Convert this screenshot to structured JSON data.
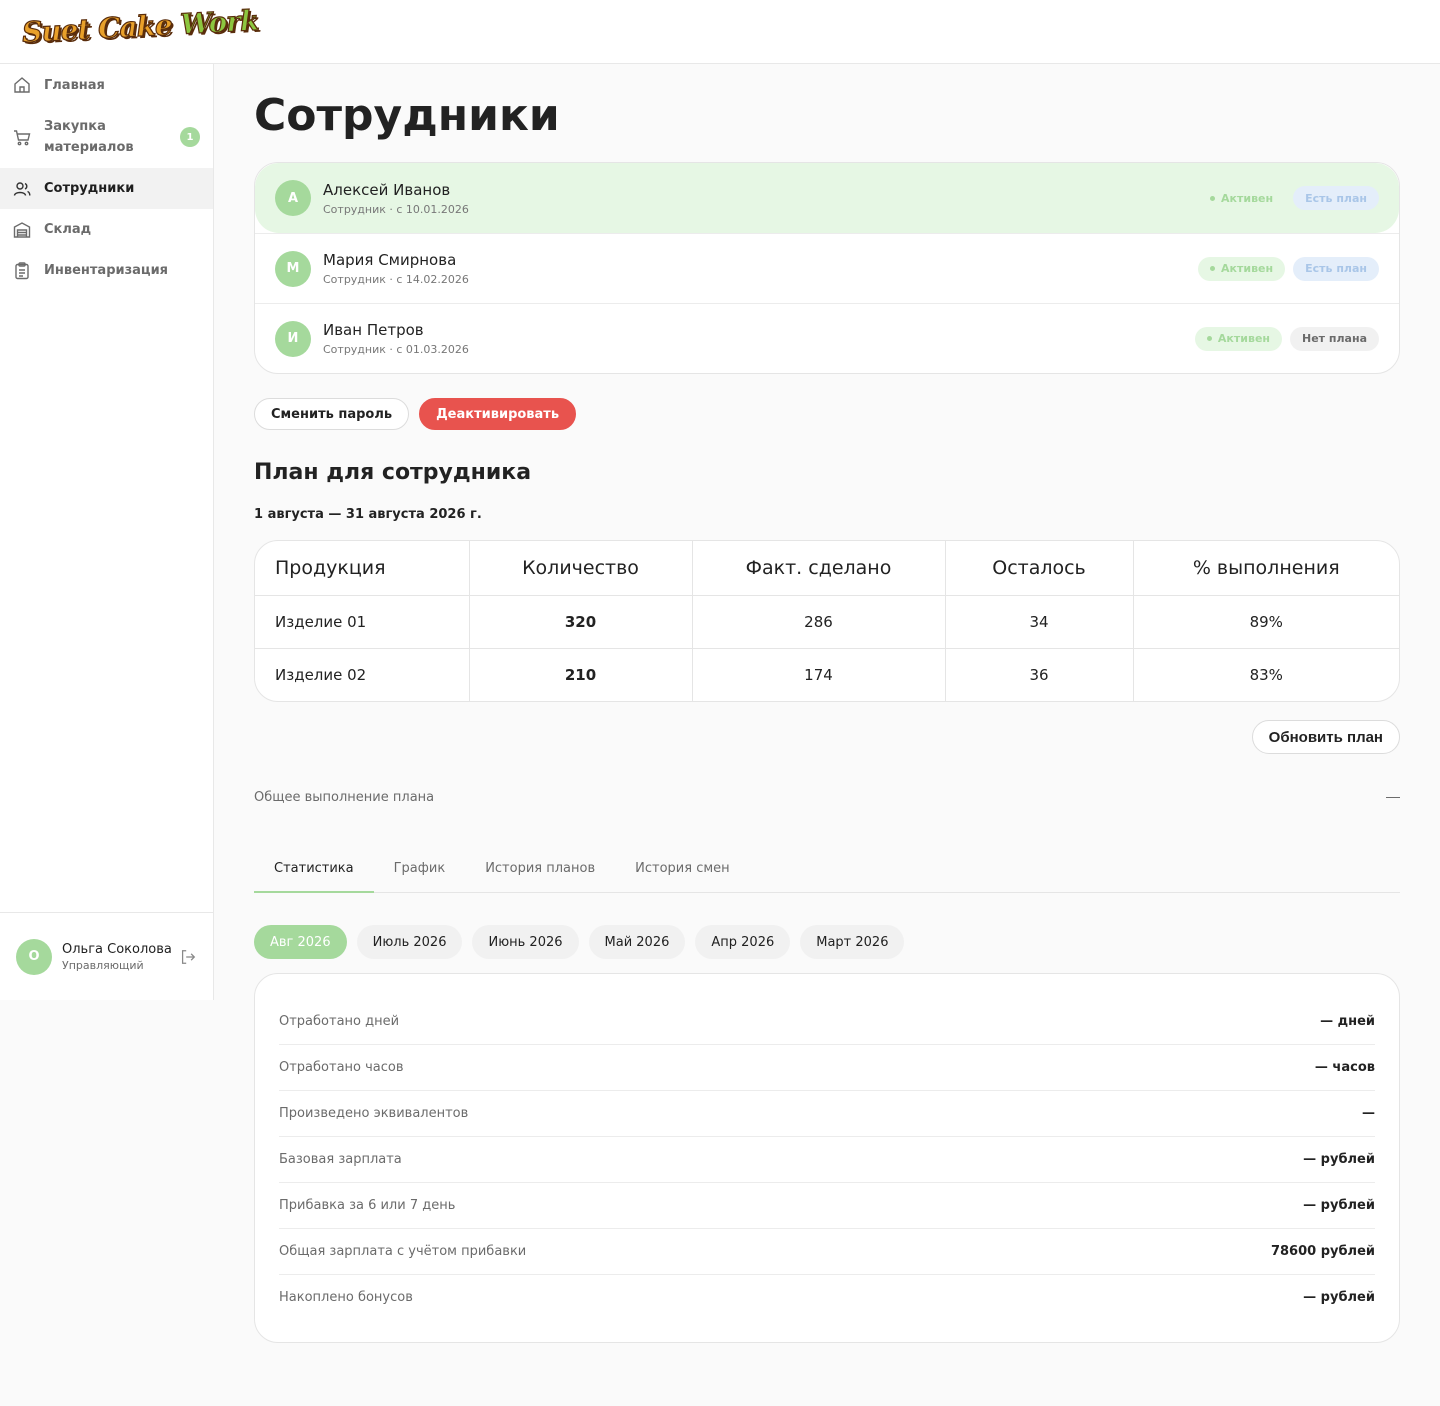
{
  "app": {
    "logo_text_a": "Suet Cake ",
    "logo_text_b": "Work"
  },
  "sidebar": {
    "items": [
      {
        "label": "Главная",
        "icon": "home-icon"
      },
      {
        "label": "Закупка материалов",
        "icon": "cart-icon",
        "badge": "1"
      },
      {
        "label": "Сотрудники",
        "icon": "users-icon",
        "active": true
      },
      {
        "label": "Склад",
        "icon": "warehouse-icon"
      },
      {
        "label": "Инвентаризация",
        "icon": "clipboard-icon"
      }
    ],
    "user": {
      "initial": "О",
      "name": "Ольга Соколова",
      "role": "Управляющий"
    }
  },
  "page": {
    "title": "Сотрудники"
  },
  "employees": [
    {
      "initial": "А",
      "name": "Алексей Иванов",
      "sub": "Сотрудник · с 10.01.2026",
      "status": "Активен",
      "plan": "Есть план",
      "has_plan": true,
      "selected": true
    },
    {
      "initial": "М",
      "name": "Мария Смирнова",
      "sub": "Сотрудник · с 14.02.2026",
      "status": "Активен",
      "plan": "Есть план",
      "has_plan": true,
      "selected": false
    },
    {
      "initial": "И",
      "name": "Иван Петров",
      "sub": "Сотрудник · с 01.03.2026",
      "status": "Активен",
      "plan": "Нет плана",
      "has_plan": false,
      "selected": false
    }
  ],
  "actions": {
    "change_password": "Сменить пароль",
    "deactivate": "Деактивировать"
  },
  "plan": {
    "title": "План для сотрудника",
    "period": "1 августа — 31 августа 2026 г.",
    "columns": [
      "Продукция",
      "Количество",
      "Факт. сделано",
      "Осталось",
      "% выполнения"
    ],
    "rows": [
      [
        "Изделие 01",
        "320",
        "286",
        "34",
        "89%"
      ],
      [
        "Изделие 02",
        "210",
        "174",
        "36",
        "83%"
      ]
    ],
    "update_button": "Обновить план"
  },
  "overall": {
    "label": "Общее выполнение плана"
  },
  "tabs": [
    "Статистика",
    "График",
    "История планов",
    "История смен"
  ],
  "months": [
    "Авг 2026",
    "Июль 2026",
    "Июнь 2026",
    "Май 2026",
    "Апр 2026",
    "Март 2026"
  ],
  "stats": [
    {
      "label": "Отработано дней",
      "value": "— дней"
    },
    {
      "label": "Отработано часов",
      "value": "— часов"
    },
    {
      "label": "Произведено эквивалентов",
      "value": "—"
    },
    {
      "label": "Базовая зарплата",
      "value": "— рублей"
    },
    {
      "label": "Прибавка за 6 или 7 день",
      "value": "— рублей"
    },
    {
      "label": "Общая зарплата с учётом прибавки",
      "value": "78600 рублей"
    },
    {
      "label": "Накоплено бонусов",
      "value": "— рублей"
    }
  ],
  "colors": {
    "accent": "#a5d99c",
    "selected_bg": "#e6f7e4",
    "danger": "#e8534e"
  }
}
